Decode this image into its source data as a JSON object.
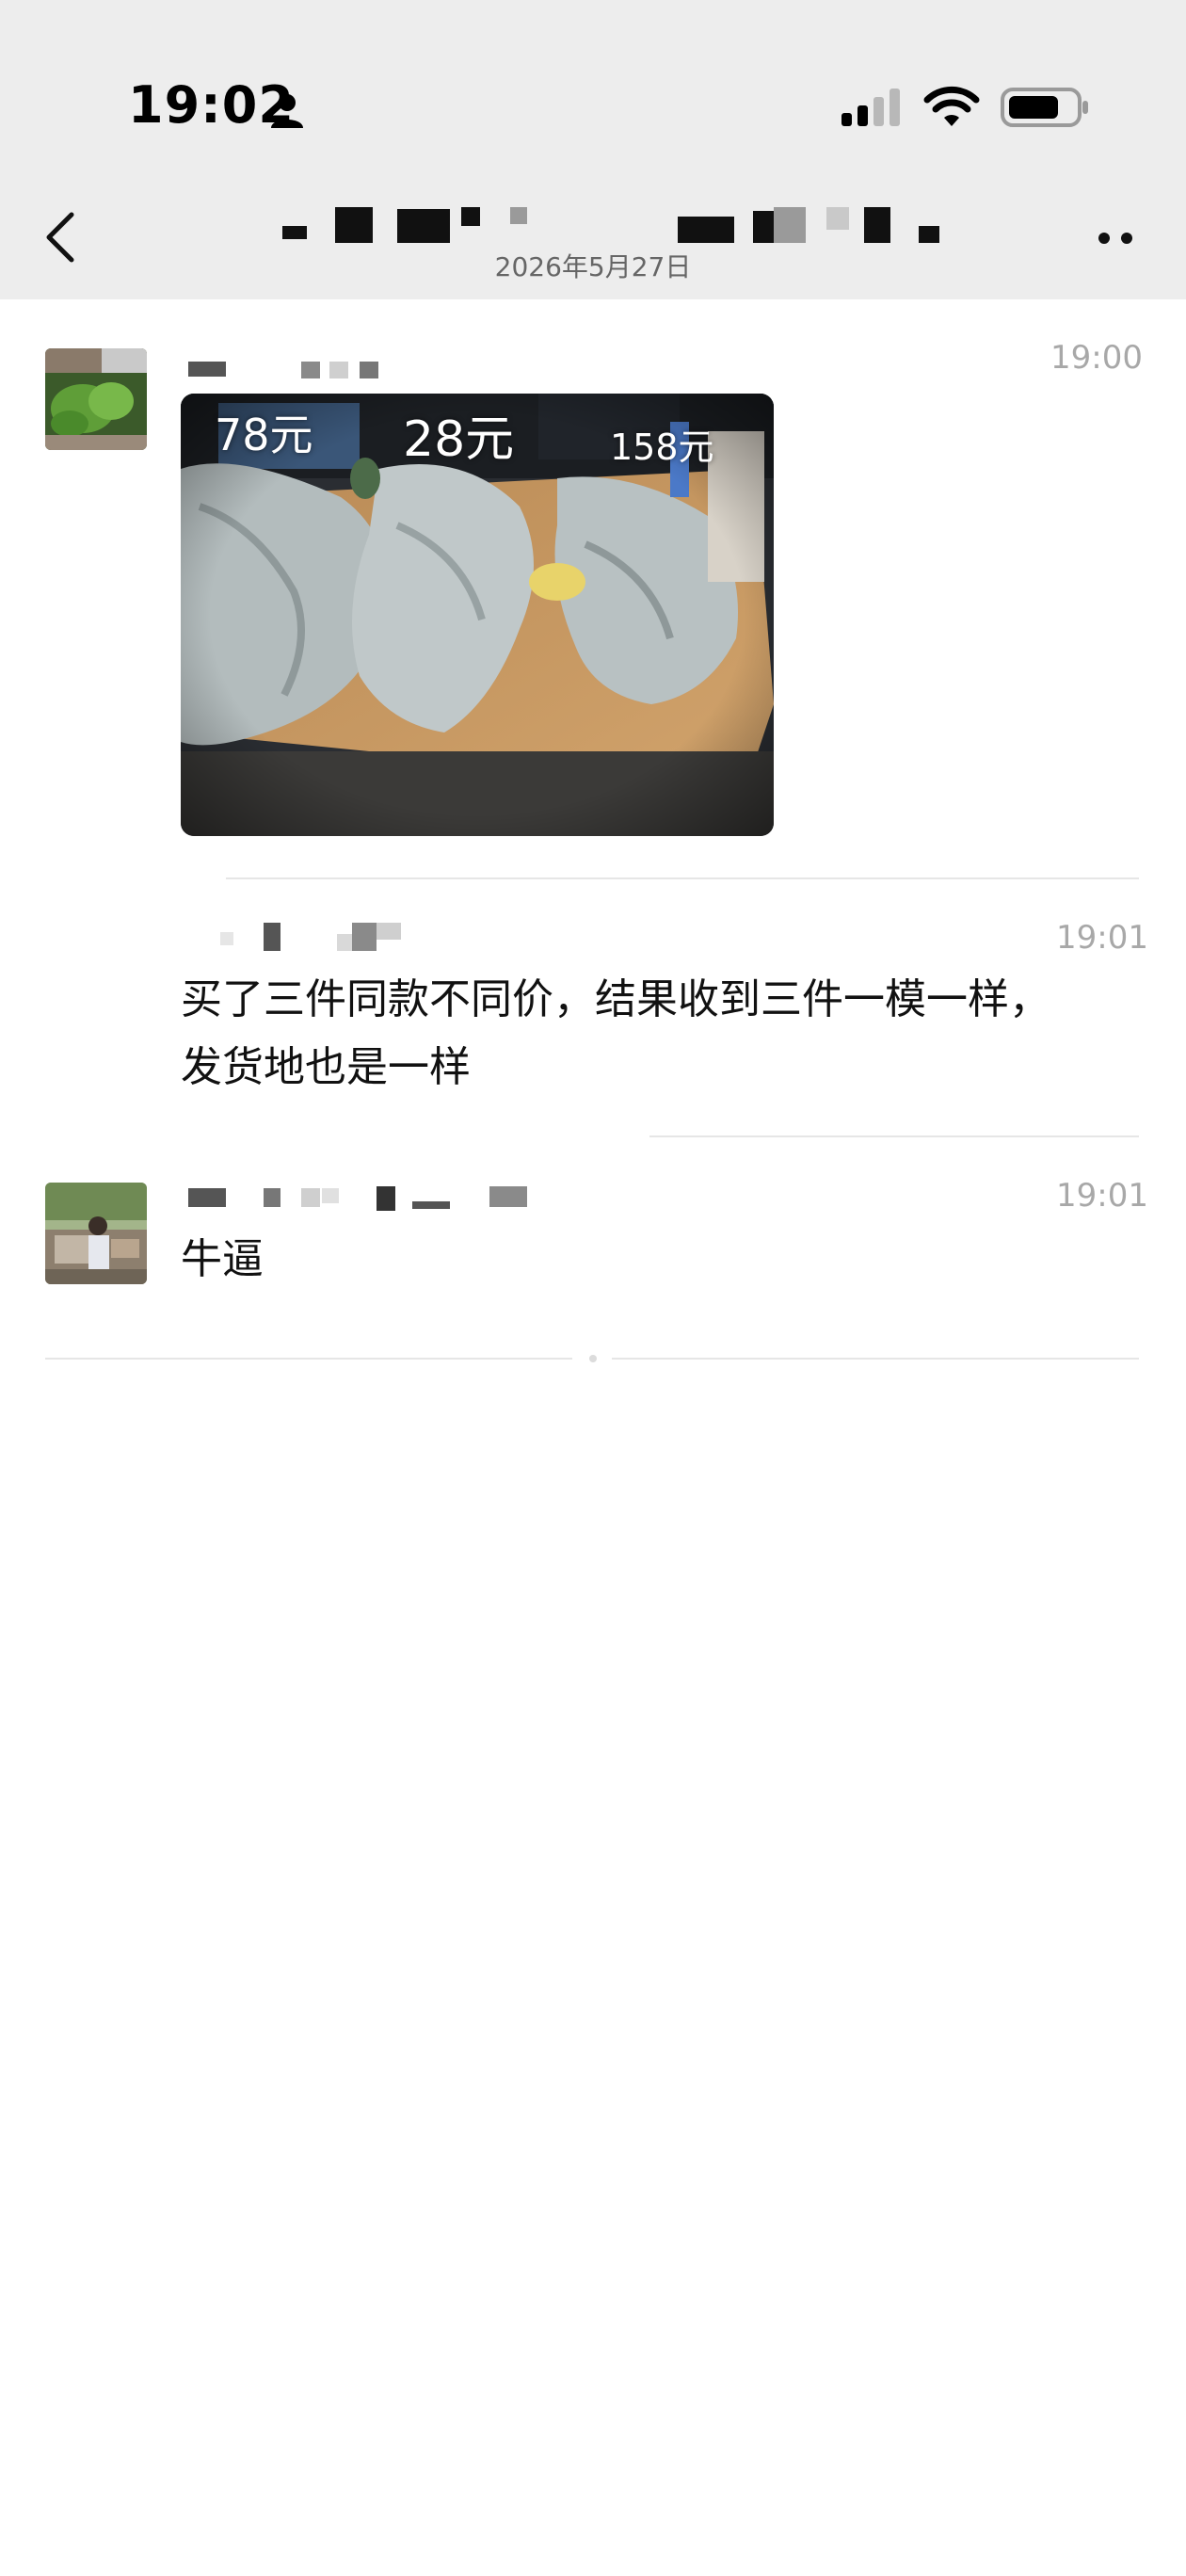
{
  "status_bar": {
    "time": "19:02"
  },
  "header": {
    "date": "2026年5月27日",
    "back_icon": "chevron-left-icon",
    "more_icon": "more-dots-icon"
  },
  "messages": [
    {
      "time": "19:00",
      "type": "image",
      "image_labels": [
        "78元",
        "28元",
        "158元"
      ]
    },
    {
      "time": "19:01",
      "type": "text",
      "lines": [
        "买了三件同款不同价，结果收到三件一模一样，",
        "发货地也是一样"
      ]
    },
    {
      "time": "19:01",
      "type": "text",
      "lines": [
        "牛逼"
      ]
    }
  ],
  "colors": {
    "header_bg": "#ededed",
    "page_bg": "#ffffff",
    "timestamp": "#a8a8a8"
  }
}
